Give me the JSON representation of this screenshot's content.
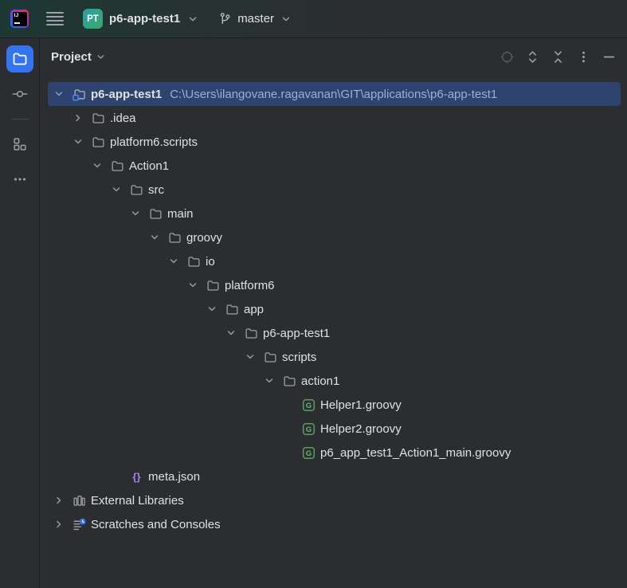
{
  "titlebar": {
    "logo_text": "IJ",
    "project_avatar": "PT",
    "project_name": "p6-app-test1",
    "branch_name": "master",
    "icons": [
      "intellij-logo-icon",
      "main-menu-icon",
      "chevron-down-icon",
      "git-branch-icon",
      "chevron-down-icon"
    ]
  },
  "sidebar": {
    "items": [
      {
        "name": "project",
        "icon": "project-tool-icon",
        "active": true
      },
      {
        "name": "commit",
        "icon": "commit-tool-icon",
        "active": false
      },
      {
        "name": "divider"
      },
      {
        "name": "structure",
        "icon": "structure-tool-icon",
        "active": false
      },
      {
        "name": "more",
        "icon": "more-tools-icon",
        "active": false
      }
    ]
  },
  "panel": {
    "title": "Project",
    "actions": [
      {
        "name": "locate-opened-file",
        "icon": "target-icon",
        "disabled": true
      },
      {
        "name": "expand-all",
        "icon": "expand-all-icon",
        "disabled": false
      },
      {
        "name": "collapse-all",
        "icon": "collapse-all-icon",
        "disabled": false
      },
      {
        "name": "more-options",
        "icon": "kebab-menu-icon",
        "disabled": false
      },
      {
        "name": "hide-panel",
        "icon": "minimize-icon",
        "disabled": false
      }
    ]
  },
  "tree": {
    "rows": [
      {
        "level": 0,
        "icon": "project-folder",
        "state": "expanded",
        "label": "p6-app-test1",
        "path": "C:\\Users\\ilangovane.ragavanan\\GIT\\applications\\p6-app-test1",
        "selected": true,
        "bold": true
      },
      {
        "level": 1,
        "icon": "folder",
        "state": "collapsed",
        "label": ".idea"
      },
      {
        "level": 1,
        "icon": "folder",
        "state": "expanded",
        "label": "platform6.scripts"
      },
      {
        "level": 2,
        "icon": "folder",
        "state": "expanded",
        "label": "Action1"
      },
      {
        "level": 3,
        "icon": "folder",
        "state": "expanded",
        "label": "src"
      },
      {
        "level": 4,
        "icon": "folder",
        "state": "expanded",
        "label": "main"
      },
      {
        "level": 5,
        "icon": "folder",
        "state": "expanded",
        "label": "groovy"
      },
      {
        "level": 6,
        "icon": "folder",
        "state": "expanded",
        "label": "io"
      },
      {
        "level": 7,
        "icon": "folder",
        "state": "expanded",
        "label": "platform6"
      },
      {
        "level": 8,
        "icon": "folder",
        "state": "expanded",
        "label": "app"
      },
      {
        "level": 9,
        "icon": "folder",
        "state": "expanded",
        "label": "p6-app-test1"
      },
      {
        "level": 10,
        "icon": "folder",
        "state": "expanded",
        "label": "scripts"
      },
      {
        "level": 11,
        "icon": "folder",
        "state": "expanded",
        "label": "action1"
      },
      {
        "level": 12,
        "icon": "groovy",
        "state": "none",
        "label": "Helper1.groovy"
      },
      {
        "level": 12,
        "icon": "groovy",
        "state": "none",
        "label": "Helper2.groovy"
      },
      {
        "level": 12,
        "icon": "groovy",
        "state": "none",
        "label": "p6_app_test1_Action1_main.groovy"
      },
      {
        "level": 3,
        "icon": "json",
        "state": "none",
        "label": "meta.json"
      },
      {
        "level": 0,
        "icon": "library",
        "state": "collapsed",
        "label": "External Libraries"
      },
      {
        "level": 0,
        "icon": "scratches",
        "state": "collapsed",
        "label": "Scratches and Consoles"
      }
    ]
  },
  "colors": {
    "accent": "#3574f0",
    "selection": "#2e436e",
    "panel_bg": "#2b2d30",
    "border": "#1e1f22",
    "text": "#dfe1e5",
    "dim_icon": "#9da2a8",
    "path_text": "#9fafd0",
    "groovy_green": "#57a05c",
    "json_purple": "#a780ec",
    "avatar_teal": "#24a1a8"
  }
}
